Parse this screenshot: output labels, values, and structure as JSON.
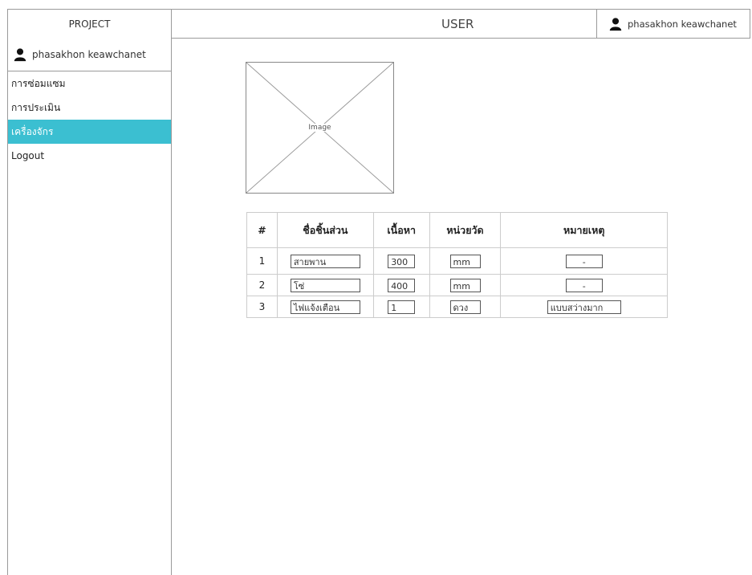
{
  "header": {
    "project_label": "PROJECT",
    "title": "USER",
    "user_name": "phasakhon keawchanet"
  },
  "sidebar": {
    "user_name": "phasakhon keawchanet",
    "items": [
      {
        "label": "การซ่อมแซม"
      },
      {
        "label": "การประเมิน"
      },
      {
        "label": "เครื่องจักร",
        "active": true
      },
      {
        "label": "Logout"
      }
    ]
  },
  "image_placeholder": {
    "label": "Image"
  },
  "table": {
    "headers": [
      "#",
      "ชื่อชิ้นส่วน",
      "เนื้อหา",
      "หน่วยวัด",
      "หมายเหตุ"
    ],
    "rows": [
      {
        "no": "1",
        "name": "สายพาน",
        "amount": "300",
        "unit": "mm",
        "note": "-"
      },
      {
        "no": "2",
        "name": "โซ่",
        "amount": "400",
        "unit": "mm",
        "note": "-"
      },
      {
        "no": "3",
        "name": "ไฟแจ้งเตือน",
        "amount": "1",
        "unit": "ดวง",
        "note": "แบบสว่างมาก"
      }
    ]
  },
  "colors": {
    "active_nav_bg": "#3bbfd1",
    "border": "#9a9a9a"
  },
  "icons": [
    "user-icon"
  ]
}
